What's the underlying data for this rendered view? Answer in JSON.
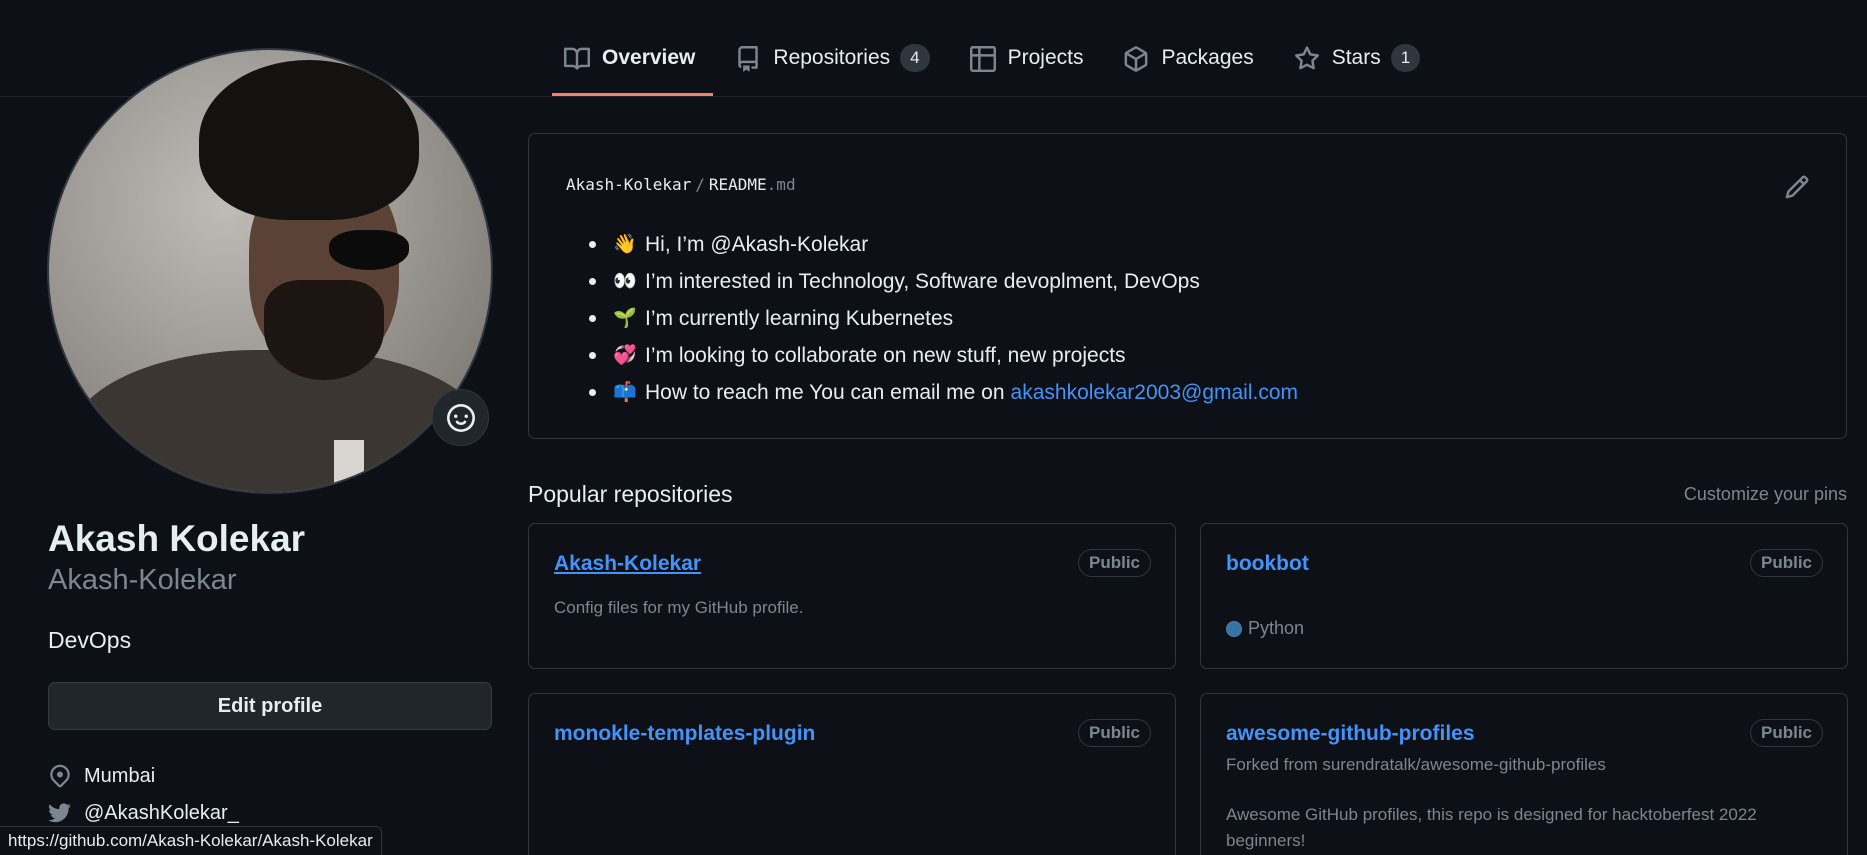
{
  "tabs": [
    {
      "label": "Overview",
      "icon": "book-icon",
      "active": true
    },
    {
      "label": "Repositories",
      "icon": "repo-icon",
      "count": "4"
    },
    {
      "label": "Projects",
      "icon": "table-icon"
    },
    {
      "label": "Packages",
      "icon": "package-icon"
    },
    {
      "label": "Stars",
      "icon": "star-icon",
      "count": "1"
    }
  ],
  "profile": {
    "name": "Akash Kolekar",
    "login": "Akash-Kolekar",
    "bio": "DevOps",
    "edit_label": "Edit profile",
    "location": "Mumbai",
    "twitter": "@AkashKolekar_"
  },
  "readme": {
    "owner": "Akash-Kolekar",
    "sep": "/",
    "file_base": "README",
    "file_ext": ".md",
    "items": [
      {
        "emoji": "👋",
        "text": "Hi, I’m @Akash-Kolekar"
      },
      {
        "emoji": "👀",
        "text": "I’m interested in Technology, Software devoplment, DevOps"
      },
      {
        "emoji": "🌱",
        "text": "I’m currently learning Kubernetes"
      },
      {
        "emoji": "💞",
        "text": "I’m looking to collaborate on new stuff, new projects"
      },
      {
        "emoji": "📫",
        "text": "How to reach me You can email me on",
        "link": "akashkolekar2003@gmail.com"
      }
    ]
  },
  "popular": {
    "title": "Popular repositories",
    "customize": "Customize your pins",
    "repos": [
      {
        "name": "Akash-Kolekar",
        "visibility": "Public",
        "description": "Config files for my GitHub profile."
      },
      {
        "name": "bookbot",
        "visibility": "Public",
        "language": "Python",
        "language_color": "#3572A5"
      },
      {
        "name": "monokle-templates-plugin",
        "visibility": "Public"
      },
      {
        "name": "awesome-github-profiles",
        "visibility": "Public",
        "forked_from": "Forked from surendratalk/awesome-github-profiles",
        "description": "Awesome GitHub profiles, this repo is designed for hacktoberfest 2022 beginners!"
      }
    ]
  },
  "statusbar": {
    "url": "https://github.com/Akash-Kolekar/Akash-Kolekar"
  },
  "colors": {
    "accent": "#f78166",
    "link": "#4493f8",
    "background": "#0d1117",
    "border": "#30363d"
  }
}
